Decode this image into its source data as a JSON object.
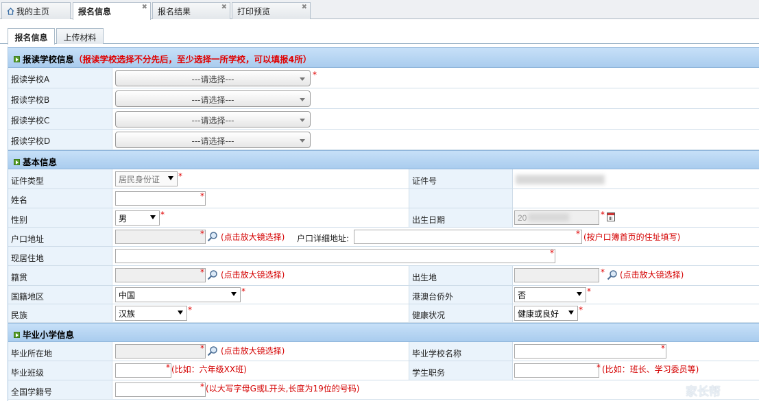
{
  "top_tabs": [
    {
      "label": "我的主页",
      "closable": false,
      "active": false,
      "icon": "home-icon"
    },
    {
      "label": "报名信息",
      "closable": true,
      "active": true
    },
    {
      "label": "报名结果",
      "closable": true,
      "active": false
    },
    {
      "label": "打印预览",
      "closable": true,
      "active": false
    }
  ],
  "close_glyph": "✖",
  "sub_tabs": [
    {
      "label": "报名信息",
      "active": true
    },
    {
      "label": "上传材料",
      "active": false
    }
  ],
  "required_mark": "*",
  "magnify_hint": "(点击放大镜选择)",
  "sections": {
    "school": {
      "title": "报读学校信息",
      "note": "（报读学校选择不分先后，至少选择一所学校，可以填报4所）"
    },
    "basic": {
      "title": "基本信息"
    },
    "primary": {
      "title": "毕业小学信息"
    }
  },
  "school_rows": [
    {
      "label": "报读学校A",
      "value": "---请选择---",
      "required": true
    },
    {
      "label": "报读学校B",
      "value": "---请选择---",
      "required": false
    },
    {
      "label": "报读学校C",
      "value": "---请选择---",
      "required": false
    },
    {
      "label": "报读学校D",
      "value": "---请选择---",
      "required": false
    }
  ],
  "basic": {
    "id_type_label": "证件类型",
    "id_type_value": "居民身份证",
    "id_no_label": "证件号",
    "name_label": "姓名",
    "name_value": "",
    "gender_label": "性别",
    "gender_value": "男",
    "birth_label": "出生日期",
    "birth_value": "20",
    "hukou_label": "户口地址",
    "hukou_value": "",
    "hukou_detail_label": "户口详细地址:",
    "hukou_detail_value": "",
    "hukou_detail_hint": "(按户口簿首页的住址填写)",
    "residence_label": "现居住地",
    "residence_value": "",
    "native_label": "籍贯",
    "native_value": "",
    "birthplace_label": "出生地",
    "birthplace_value": "",
    "nationality_label": "国籍地区",
    "nationality_value": "中国",
    "overseas_label": "港澳台侨外",
    "overseas_value": "否",
    "ethnicity_label": "民族",
    "ethnicity_value": "汉族",
    "health_label": "健康状况",
    "health_value": "健康或良好"
  },
  "primary": {
    "location_label": "毕业所在地",
    "location_value": "",
    "school_name_label": "毕业学校名称",
    "school_name_value": "",
    "class_label": "毕业班级",
    "class_value": "",
    "class_hint": "(比如：六年级XX班)",
    "duty_label": "学生职务",
    "duty_value": "",
    "duty_hint": "(比如：班长、学习委员等)",
    "student_no_label": "全国学籍号",
    "student_no_value": "",
    "student_no_hint": "(以大写字母G或L开头,长度为19位的号码)"
  },
  "watermark": "家长帮"
}
